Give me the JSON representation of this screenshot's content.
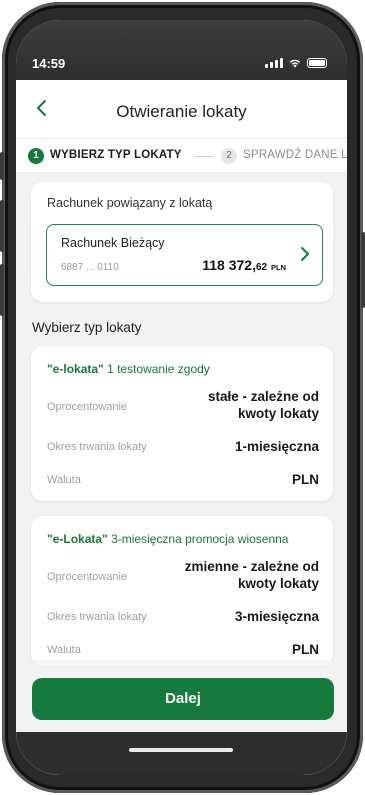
{
  "status": {
    "time": "14:59"
  },
  "header": {
    "title": "Otwieranie lokaty"
  },
  "steps": [
    {
      "number": "1",
      "label": "WYBIERZ TYP LOKATY"
    },
    {
      "number": "2",
      "label": "SPRAWDŹ DANE L"
    }
  ],
  "account": {
    "section_label": "Rachunek powiązany z lokatą",
    "name": "Rachunek Bieżący",
    "number": "6887 ... 0110",
    "balance_main": "118 372,",
    "balance_decimals": "62",
    "currency": "PLN"
  },
  "offers_title": "Wybierz typ lokaty",
  "offers": [
    {
      "name_quoted": "\"e-lokata\"",
      "name_rest": " 1 testowanie zgody",
      "rows": [
        {
          "label": "Oprocentowanie",
          "value_line1": "stałe - zależne od",
          "value_line2": "kwoty lokaty"
        },
        {
          "label": "Okres trwania lokaty",
          "value": "1-miesięczna"
        },
        {
          "label": "Waluta",
          "value": "PLN"
        }
      ]
    },
    {
      "name_quoted": "\"e-Lokata\"",
      "name_rest": " 3-miesięczna promocja wiosenna",
      "rows": [
        {
          "label": "Oprocentowanie",
          "value_line1": "zmienne - zależne od",
          "value_line2": "kwoty lokaty"
        },
        {
          "label": "Okres trwania lokaty",
          "value": "3-miesięczna"
        },
        {
          "label": "Waluta",
          "value": "PLN"
        }
      ]
    }
  ],
  "button": {
    "label": "Dalej"
  },
  "colors": {
    "accent": "#157a3b",
    "border": "#1d8a47"
  },
  "icons": [
    "back-arrow-icon",
    "chevron-right-icon",
    "signal-icon",
    "wifi-icon",
    "battery-icon"
  ]
}
